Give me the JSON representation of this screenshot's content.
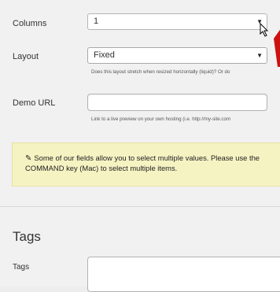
{
  "fields": {
    "columns": {
      "label": "Columns",
      "value": "1"
    },
    "layout": {
      "label": "Layout",
      "value": "Fixed",
      "hint": "Does this layout stretch when resized horizontally (liquid)? Or do"
    },
    "demo_url": {
      "label": "Demo URL",
      "value": "",
      "hint": "Link to a live preview on your own hosting (i.e. http://my-site.com"
    }
  },
  "notice": {
    "line1": "Some of our fields allow you to select multiple values. Please use the",
    "line2": "COMMAND key (Mac) to select multiple items.",
    "icon": "pencil-icon"
  },
  "tags": {
    "title": "Tags",
    "label": "Tags",
    "value": ""
  },
  "colors": {
    "notice_bg": "#f6f3c3",
    "marker": "#cc1111"
  }
}
